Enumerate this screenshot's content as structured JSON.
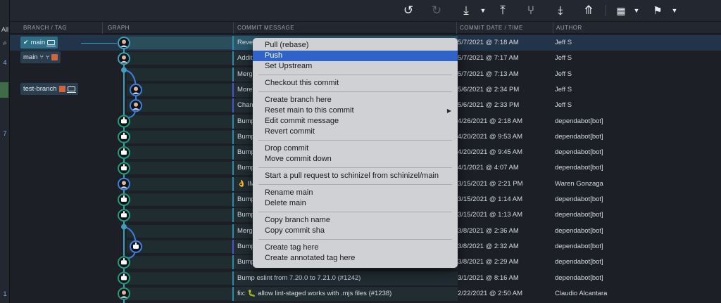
{
  "colors": {
    "accent": "#2f63c9",
    "graph_teal": "#3d9fba",
    "graph_blue": "#3b7fe0",
    "node_green": "#1f9c7a",
    "bg": "#1c1f26"
  },
  "rail": {
    "top_label": "All",
    "search_icon": "search-icon",
    "badge_a": "4",
    "badge_b": "7",
    "badge_c": "1"
  },
  "toolbar": {
    "icons": [
      "undo-icon",
      "redo-icon",
      "pull-icon",
      "caret-down-icon",
      "push-icon",
      "branch-icon",
      "stash-icon",
      "pop-stash-icon",
      "layout-icon",
      "caret-down-icon",
      "flag-icon",
      "caret-down-icon"
    ]
  },
  "columns": {
    "branch_tag": "BRANCH / TAG",
    "graph": "GRAPH",
    "message": "COMMIT MESSAGE",
    "date": "COMMIT DATE / TIME",
    "author": "AUTHOR"
  },
  "branches": [
    {
      "label": "main",
      "check": "✔"
    },
    {
      "label": "main"
    },
    {
      "label": "test-branch"
    }
  ],
  "commits": [
    {
      "message": "Revert",
      "date": "5/7/2021 @ 7:18 AM",
      "author": "Jeff S"
    },
    {
      "message": "Additi",
      "date": "5/7/2021 @ 7:17 AM",
      "author": "Jeff S"
    },
    {
      "message": "Merge",
      "date": "5/7/2021 @ 7:13 AM",
      "author": "Jeff S"
    },
    {
      "message": "More",
      "date": "5/6/2021 @ 2:34 PM",
      "author": "Jeff S"
    },
    {
      "message": "Chan",
      "date": "5/6/2021 @ 2:33 PM",
      "author": "Jeff S"
    },
    {
      "message": "Bump",
      "date": "4/26/2021 @ 2:18 AM",
      "author": "dependabot[bot]"
    },
    {
      "message": "Bump",
      "date": "4/20/2021 @ 9:53 AM",
      "author": "dependabot[bot]"
    },
    {
      "message": "Bump",
      "date": "4/20/2021 @ 9:45 AM",
      "author": "dependabot[bot]"
    },
    {
      "message": "Bump",
      "date": "4/1/2021 @ 4:07 AM",
      "author": "dependabot[bot]"
    },
    {
      "message": "👌 IM",
      "date": "3/15/2021 @ 2:21 PM",
      "author": "Waren Gonzaga"
    },
    {
      "message": "Bump",
      "date": "3/15/2021 @ 1:14 AM",
      "author": "dependabot[bot]"
    },
    {
      "message": "Bump",
      "date": "3/15/2021 @ 1:13 AM",
      "author": "dependabot[bot]"
    },
    {
      "message": "Merg",
      "date": "3/8/2021 @ 2:36 AM",
      "author": "dependabot[bot]"
    },
    {
      "message": "Bump",
      "date": "3/8/2021 @ 2:32 AM",
      "author": "dependabot[bot]"
    },
    {
      "message": "Bump",
      "date": "3/8/2021 @ 2:29 AM",
      "author": "dependabot[bot]"
    },
    {
      "message": "Bump eslint from 7.20.0 to 7.21.0 (#1242)",
      "date": "3/1/2021 @ 8:16 AM",
      "author": "dependabot[bot]"
    },
    {
      "message": "fix: 🐛 allow lint-staged works with .mjs files (#1238)",
      "date": "2/22/2021 @ 2:50 AM",
      "author": "Claudio Alcantara"
    }
  ],
  "context_menu": {
    "groups": [
      [
        "Pull (rebase)",
        "Push",
        "Set Upstream"
      ],
      [
        "Checkout this commit"
      ],
      [
        "Create branch here",
        "Reset main to this commit",
        "Edit commit message",
        "Revert commit"
      ],
      [
        "Drop commit",
        "Move commit down"
      ],
      [
        "Start a pull request to schinizel from schinizel/main"
      ],
      [
        "Rename main",
        "Delete main"
      ],
      [
        "Copy branch name",
        "Copy commit sha"
      ],
      [
        "Create tag here",
        "Create annotated tag here"
      ]
    ],
    "highlighted": "Push",
    "submenu_item": "Reset main to this commit",
    "submenu_arrow": "▶"
  }
}
